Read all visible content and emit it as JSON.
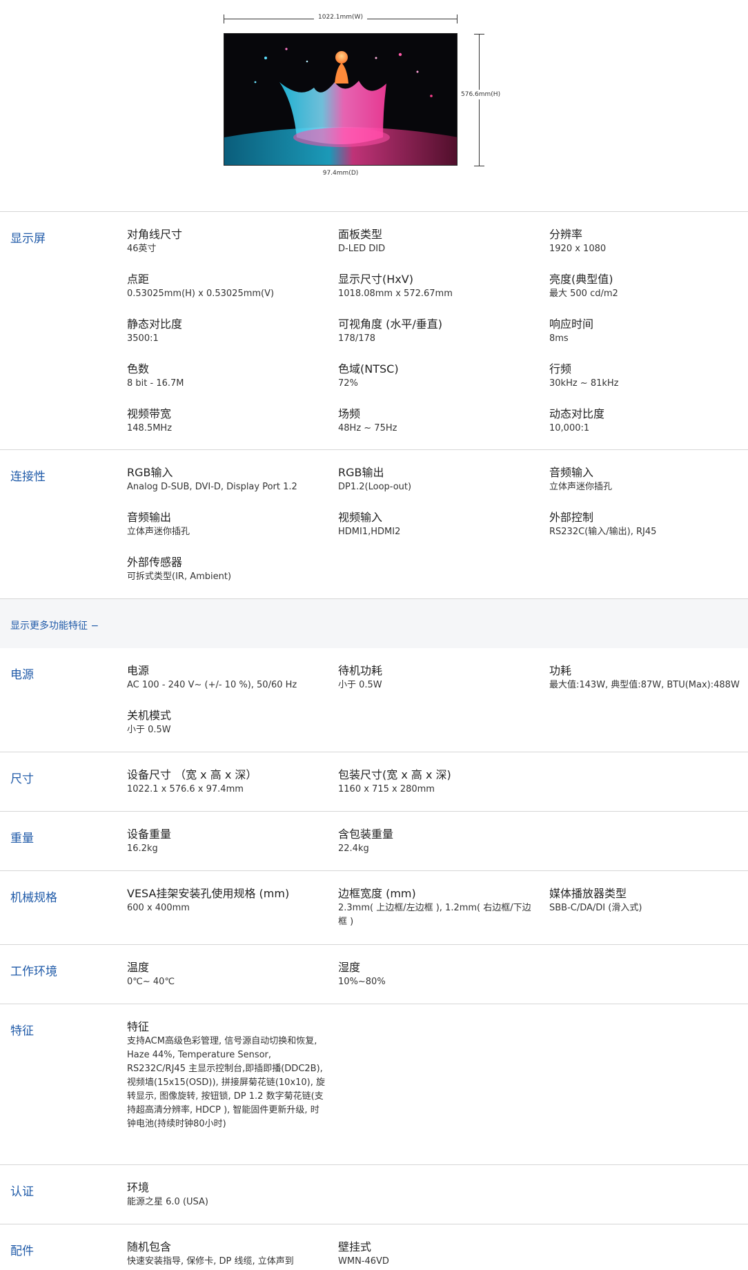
{
  "figure": {
    "width_label": "1022.1mm(W)",
    "height_label": "576.6mm(H)",
    "depth_label": "97.4mm(D)"
  },
  "more_link": "显示更多功能特征 −",
  "sections": {
    "display": {
      "title": "显示屏",
      "items": [
        {
          "k": "对角线尺寸",
          "v": "46英寸"
        },
        {
          "k": "面板类型",
          "v": "D-LED DID"
        },
        {
          "k": "分辨率",
          "v": "1920 x 1080"
        },
        {
          "k": "点距",
          "v": "0.53025mm(H) x 0.53025mm(V)"
        },
        {
          "k": "显示尺寸(HxV)",
          "v": "1018.08mm x 572.67mm"
        },
        {
          "k": "亮度(典型值)",
          "v": "最大 500 cd/m2"
        },
        {
          "k": "静态对比度",
          "v": "3500:1"
        },
        {
          "k": "可视角度 (水平/垂直)",
          "v": "178/178"
        },
        {
          "k": "响应时间",
          "v": "8ms"
        },
        {
          "k": "色数",
          "v": "8 bit - 16.7M"
        },
        {
          "k": "色域(NTSC)",
          "v": "72%"
        },
        {
          "k": "行频",
          "v": "30kHz ~ 81kHz"
        },
        {
          "k": "视频带宽",
          "v": "148.5MHz"
        },
        {
          "k": "场频",
          "v": "48Hz ~ 75Hz"
        },
        {
          "k": "动态对比度",
          "v": "10,000:1"
        }
      ]
    },
    "connectivity": {
      "title": "连接性",
      "items": [
        {
          "k": "RGB输入",
          "v": "Analog D-SUB, DVI-D, Display Port 1.2"
        },
        {
          "k": "RGB输出",
          "v": "DP1.2(Loop-out)"
        },
        {
          "k": "音频输入",
          "v": "立体声迷你插孔"
        },
        {
          "k": "音频输出",
          "v": "立体声迷你插孔"
        },
        {
          "k": "视频输入",
          "v": "HDMI1,HDMI2"
        },
        {
          "k": "外部控制",
          "v": "RS232C(输入/输出), RJ45"
        },
        {
          "k": "外部传感器",
          "v": "可拆式类型(IR, Ambient)"
        }
      ]
    },
    "power": {
      "title": "电源",
      "items": [
        {
          "k": "电源",
          "v": "AC 100 - 240 V~ (+/- 10 %), 50/60 Hz"
        },
        {
          "k": "待机功耗",
          "v": "小于 0.5W"
        },
        {
          "k": "功耗",
          "v": "最大值:143W, 典型值:87W, BTU(Max):488W"
        },
        {
          "k": "关机模式",
          "v": "小于 0.5W"
        }
      ]
    },
    "size": {
      "title": "尺寸",
      "items": [
        {
          "k": "设备尺寸 （宽 x 高 x 深）",
          "v": "1022.1 x 576.6 x 97.4mm"
        },
        {
          "k": "包装尺寸(宽 x 高 x 深)",
          "v": "1160 x 715 x 280mm"
        }
      ]
    },
    "weight": {
      "title": "重量",
      "items": [
        {
          "k": "设备重量",
          "v": "16.2kg"
        },
        {
          "k": "含包装重量",
          "v": "22.4kg"
        }
      ]
    },
    "mechanical": {
      "title": "机械规格",
      "items": [
        {
          "k": "VESA挂架安装孔使用规格 (mm)",
          "v": "600 x 400mm"
        },
        {
          "k": "边框宽度 (mm)",
          "v": "2.3mm( 上边框/左边框 ), 1.2mm( 右边框/下边框 )"
        },
        {
          "k": "媒体播放器类型",
          "v": "SBB-C/DA/DI (滑入式)"
        }
      ]
    },
    "environment": {
      "title": "工作环境",
      "items": [
        {
          "k": "温度",
          "v": "0℃~ 40℃"
        },
        {
          "k": "湿度",
          "v": "10%~80%"
        }
      ]
    },
    "features": {
      "title": "特征",
      "items": [
        {
          "k": "特征",
          "v": "支持ACM高级色彩管理, 信号源自动切换和恢复, Haze 44%, Temperature Sensor, RS232C/RJ45 主显示控制台,即插即播(DDC2B), 视频墙(15x15(OSD)), 拼接屏菊花链(10x10), 旋转显示, 图像旋转, 按钮锁, DP 1.2 数字菊花链(支持超高清分辨率, HDCP ), 智能固件更新升级, 时钟电池(持续时钟80小时)"
        }
      ]
    },
    "certification": {
      "title": "认证",
      "items": [
        {
          "k": "环境",
          "v": "能源之星 6.0 (USA)"
        }
      ]
    },
    "accessories": {
      "title": "配件",
      "items": [
        {
          "k": "随机包含",
          "v": "快速安装指导, 保修卡, DP 线缆, 立体声到"
        },
        {
          "k": "壁挂式",
          "v": "WMN-46VD"
        }
      ]
    }
  }
}
